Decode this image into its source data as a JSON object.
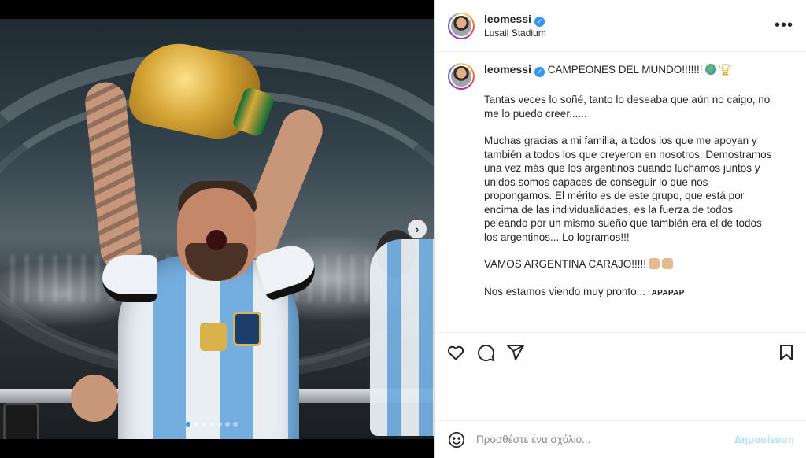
{
  "post": {
    "username": "leomessi",
    "verified": true,
    "location": "Lusail Stadium",
    "caption": {
      "headline": "CAMPEONES DEL MUNDO!!!!!!!",
      "paragraphs": [
        "Tantas veces lo soñé, tanto lo deseaba que aún no caigo, no me lo puedo creer......",
        "Muchas gracias a mi familia, a todos los que me apoyan y también a todos los que creyeron en nosotros. Demostramos una vez más que los argentinos cuando luchamos juntos y unidos somos capaces de conseguir lo que nos propongamos. El mérito es de este grupo, que está por encima de las individualidades, es la fuerza de todos peleando por un mismo sueño que también era el de todos los argentinos... Lo logramos!!!",
        "VAMOS ARGENTINA CARAJO!!!!!",
        "Nos estamos viendo muy pronto..."
      ],
      "translate_label": "ΑΡΑΡΑΡ"
    },
    "carousel": {
      "slides": 7,
      "active_index": 0
    }
  },
  "header": {
    "more_label": "•••"
  },
  "comment": {
    "placeholder": "Προσθέστε ένα σχόλιο...",
    "post_label": "Δημοσίευση"
  },
  "icons": {
    "carousel_next": "chevron-right-icon",
    "like": "heart-icon",
    "comment": "comment-icon",
    "share": "paper-plane-icon",
    "save": "bookmark-icon",
    "emoji": "smile-icon"
  },
  "colors": {
    "accent": "#3897f0",
    "post_button_disabled": "#b2dffc",
    "text": "#262626",
    "muted": "#8e8e8e"
  }
}
